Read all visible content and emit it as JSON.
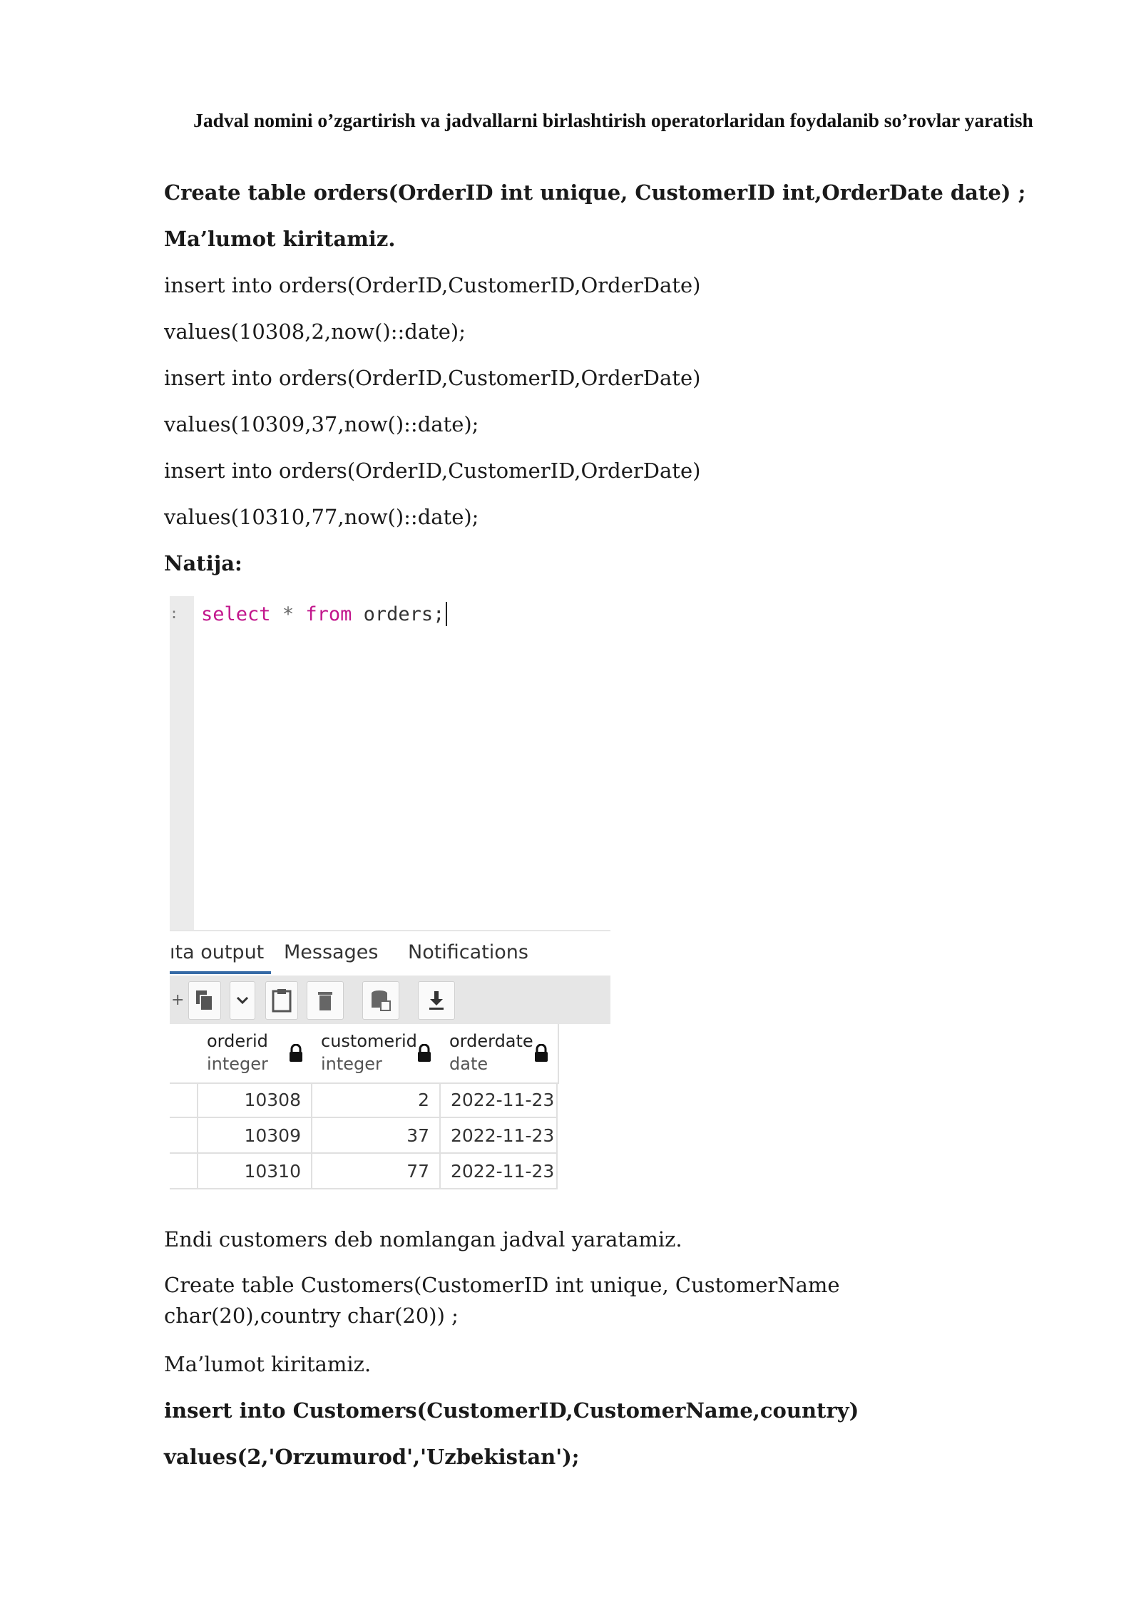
{
  "title": "Jadval nomini o’zgartirish va jadvallarni birlashtirish operatorlaridan foydalanib so’rovlar yaratish",
  "lines": {
    "create_orders": "Create table orders(OrderID  int unique, CustomerID int,OrderDate date) ;",
    "malumot1": "Ma’lumot kiritamiz.",
    "insert1": "insert into orders(OrderID,CustomerID,OrderDate)",
    "values1": "values(10308,2,now()::date);",
    "insert2": "insert into orders(OrderID,CustomerID,OrderDate)",
    "values2": "values(10309,37,now()::date);",
    "insert3": "insert into orders(OrderID,CustomerID,OrderDate)",
    "values3": "values(10310,77,now()::date);",
    "natija": "Natija:",
    "endi": "Endi  customers deb nomlangan jadval yaratamiz.",
    "create_customers": "Create table Customers(CustomerID  int unique, CustomerName char(20),country char(20)) ;",
    "malumot2": "Ma’lumot kiritamiz.",
    "insert_customers": "insert into Customers(CustomerID,CustomerName,country)",
    "values_customers": "values(2,'Orzumurod','Uzbekistan');"
  },
  "screenshot": {
    "query": {
      "select_kw": "select",
      "star": "*",
      "from_kw": "from",
      "table": "orders;"
    },
    "tabs": [
      "ıta output",
      "Messages",
      "Notifications"
    ],
    "active_tab": 0,
    "toolbar_icons": [
      "add-row-icon",
      "copy-icon",
      "chevron-down-icon",
      "paste-icon",
      "delete-icon",
      "save-data-icon",
      "download-icon"
    ],
    "columns": [
      {
        "name": "orderid",
        "type": "integer"
      },
      {
        "name": "customerid",
        "type": "integer"
      },
      {
        "name": "orderdate",
        "type": "date"
      }
    ],
    "rows": [
      [
        "10308",
        "2",
        "2022-11-23"
      ],
      [
        "10309",
        "37",
        "2022-11-23"
      ],
      [
        "10310",
        "77",
        "2022-11-23"
      ]
    ]
  }
}
